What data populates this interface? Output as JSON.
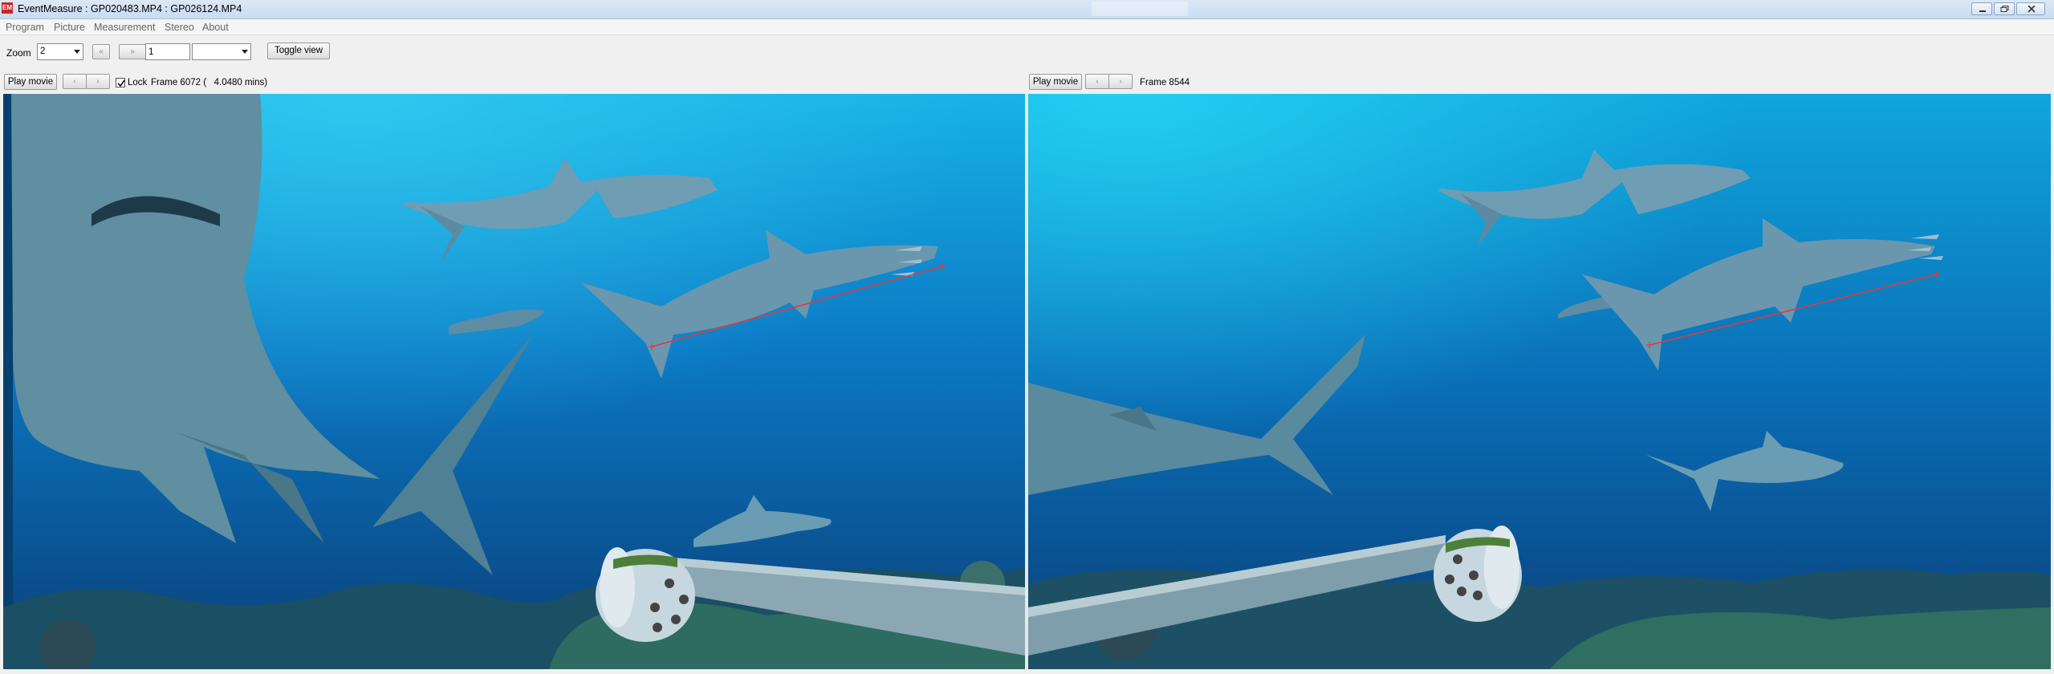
{
  "window": {
    "app_icon_text": "EM",
    "title": "EventMeasure : GP020483.MP4 : GP026124.MP4",
    "controls": [
      "minimize-icon",
      "restore-icon",
      "close-icon"
    ]
  },
  "menu": {
    "items": [
      "Program",
      "Picture",
      "Measurement",
      "Stereo",
      "About"
    ]
  },
  "toolbar": {
    "zoom_label": "Zoom",
    "zoom_value": "2",
    "step_back_glyph": "«",
    "step_forward_glyph": "»",
    "step_value": "1",
    "mode_value": "",
    "toggle_view_label": "Toggle view"
  },
  "left_view": {
    "play_label": "Play movie",
    "prev_glyph": "‹",
    "next_glyph": "›",
    "lock_label": "Lock",
    "lock_checked": true,
    "frame_text": "Frame 6072 (   4.0480 mins)"
  },
  "right_view": {
    "play_label": "Play movie",
    "prev_glyph": "‹",
    "next_glyph": "›",
    "frame_text": "Frame 8544"
  },
  "colors": {
    "measure_line": "#e53935",
    "water_top": "#17b3e6",
    "water_deep": "#0a3f78",
    "shark": "#6f9db3"
  }
}
